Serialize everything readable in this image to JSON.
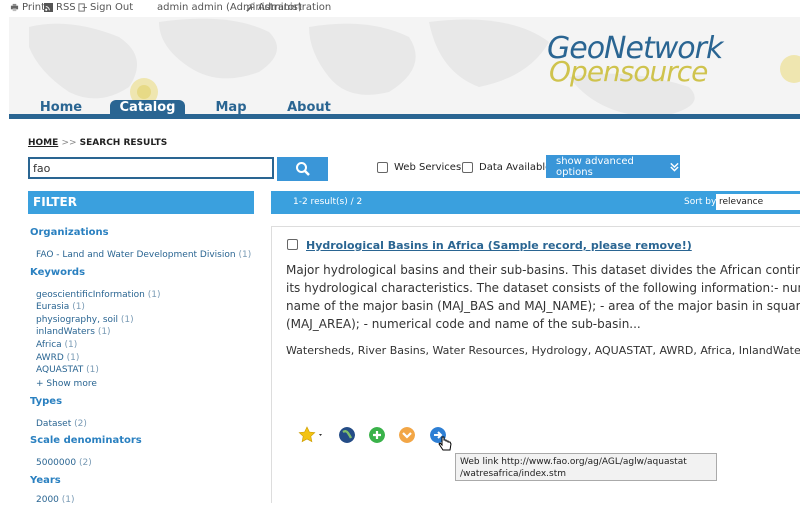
{
  "topbar": {
    "print": "Print",
    "rss": "RSS",
    "signout": "Sign Out",
    "user": "admin admin (Administrator)",
    "admin": "Administration"
  },
  "logo": {
    "line1": "GeoNetwork",
    "line2": "Opensource"
  },
  "nav": {
    "tabs": [
      "Home",
      "Catalog",
      "Map",
      "About"
    ],
    "active": "Catalog"
  },
  "breadcrumb": {
    "home": "HOME",
    "sep": ">>",
    "current": "SEARCH RESULTS"
  },
  "search": {
    "value": "fao",
    "button_icon": "search-icon"
  },
  "options": {
    "web_services": "Web Services",
    "data_available": "Data Available",
    "advanced": "show advanced options"
  },
  "filter": {
    "title": "FILTER",
    "organizations": {
      "label": "Organizations",
      "items": [
        {
          "name": "FAO - Land and Water Development Division",
          "count": "(1)"
        }
      ]
    },
    "keywords": {
      "label": "Keywords",
      "items": [
        {
          "name": "geoscientificInformation",
          "count": "(1)"
        },
        {
          "name": "Eurasia",
          "count": "(1)"
        },
        {
          "name": "physiography, soil",
          "count": "(1)"
        },
        {
          "name": "inlandWaters",
          "count": "(1)"
        },
        {
          "name": "Africa",
          "count": "(1)"
        },
        {
          "name": "AWRD",
          "count": "(1)"
        },
        {
          "name": "AQUASTAT",
          "count": "(1)"
        }
      ],
      "more": "+ Show more"
    },
    "types": {
      "label": "Types",
      "items": [
        {
          "name": "Dataset",
          "count": "(2)"
        }
      ]
    },
    "scale": {
      "label": "Scale denominators",
      "items": [
        {
          "name": "5000000",
          "count": "(2)"
        }
      ]
    },
    "years": {
      "label": "Years",
      "items": [
        {
          "name": "2000",
          "count": "(1)"
        }
      ]
    }
  },
  "results": {
    "count_text": "1-2 result(s) / 2",
    "sort_label": "Sort by",
    "sort_value": "relevance"
  },
  "record": {
    "title": "Hydrological Basins in Africa (Sample record, please remove!)",
    "abstract_lines": [
      "Major hydrological basins and their sub-basins. This dataset divides the African continent acco",
      "its hydrological characteristics. The dataset consists of the following information:- numerical c",
      "name of the major basin (MAJ_BAS and MAJ_NAME); - area of the major basin in square km",
      "(MAJ_AREA); - numerical code and name of the sub-basin..."
    ],
    "keywords": "Watersheds, River Basins, Water Resources, Hydrology, AQUASTAT, AWRD, Africa, InlandWaters",
    "actions": [
      "star-icon",
      "globe-icon",
      "add-icon",
      "download-icon",
      "weblink-icon"
    ]
  },
  "tooltip": {
    "line1": "Web link http://www.fao.org/ag/AGL/aglw/aquastat",
    "line2": "/watresafrica/index.stm"
  },
  "colors": {
    "brand": "#2a6592",
    "accent": "#3aa0de",
    "logo_yellow": "#cfc34d"
  }
}
